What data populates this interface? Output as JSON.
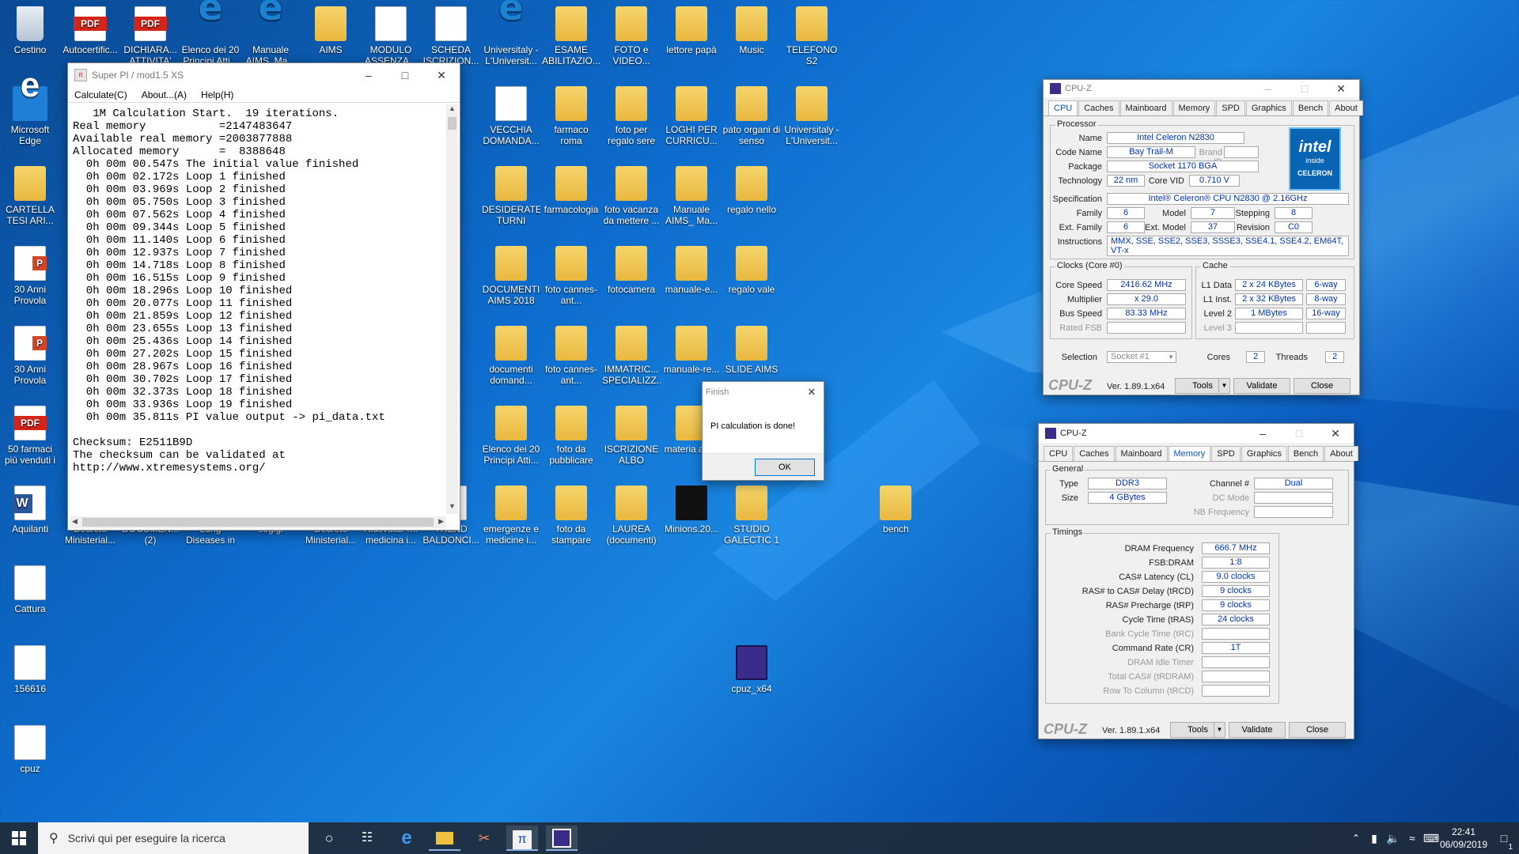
{
  "desktop_icons": [
    {
      "label": "Cestino",
      "type": "bin"
    },
    {
      "label": "Autocertific...",
      "type": "pdf"
    },
    {
      "label": "DICHIARA... ATTIVITA'",
      "type": "pdf"
    },
    {
      "label": "Elenco dei 20 Principi Atti...",
      "type": "edge"
    },
    {
      "label": "Manuale AIMS_Ma...",
      "type": "edge"
    },
    {
      "label": "AIMS",
      "type": "folder"
    },
    {
      "label": "MODULO ASSENZA...",
      "type": "doc"
    },
    {
      "label": "SCHEDA ISCRIZION...",
      "type": "doc"
    },
    {
      "label": "Universitaly - L'Universit...",
      "type": "edge"
    },
    {
      "label": "ESAME ABILITAZIO...",
      "type": "folder"
    },
    {
      "label": "FOTO e VIDEO...",
      "type": "folder"
    },
    {
      "label": "lettore papà",
      "type": "folder"
    },
    {
      "label": "Music",
      "type": "folder"
    },
    {
      "label": "TELEFONO S2",
      "type": "folder"
    },
    {
      "label": "Microsoft Edge",
      "type": "edgeblue"
    },
    {
      "label": "VECCHIA DOMANDA...",
      "type": "doc"
    },
    {
      "label": "farmaco roma",
      "type": "folder"
    },
    {
      "label": "foto per regalo sere",
      "type": "folder"
    },
    {
      "label": "LOGHI PER CURRICU...",
      "type": "folder"
    },
    {
      "label": "pato organi di senso",
      "type": "folder"
    },
    {
      "label": "Universitaly - L'Universit...",
      "type": "folder"
    },
    {
      "label": "CARTELLA TESI ARI...",
      "type": "folder"
    },
    {
      "label": "DESIDERATE TURNI INTE...",
      "type": "folder"
    },
    {
      "label": "farmacologia",
      "type": "folder"
    },
    {
      "label": "foto vacanza da mettere ...",
      "type": "folder"
    },
    {
      "label": "Manuale AIMS_ Ma...",
      "type": "folder"
    },
    {
      "label": "regalo nello",
      "type": "folder"
    },
    {
      "label": "30 Anni Provola",
      "type": "ppt"
    },
    {
      "label": "DOCUMENTI AIMS 2018",
      "type": "folder"
    },
    {
      "label": "foto cannes-ant...",
      "type": "folder"
    },
    {
      "label": "fotocamera",
      "type": "folder"
    },
    {
      "label": "manuale-e...",
      "type": "folder"
    },
    {
      "label": "regalo vale",
      "type": "folder"
    },
    {
      "label": "30 Anni Provola",
      "type": "ppt"
    },
    {
      "label": "documenti domand...",
      "type": "folder"
    },
    {
      "label": "foto cannes-ant...",
      "type": "folder"
    },
    {
      "label": "IMMATRIC... SPECIALIZZ...",
      "type": "folder"
    },
    {
      "label": "manuale-re...",
      "type": "folder"
    },
    {
      "label": "SLIDE AIMS",
      "type": "folder"
    },
    {
      "label": "50 farmaci più venduti i",
      "type": "pdf"
    },
    {
      "label": "Elenco dei 20 Principi Atti...",
      "type": "folder"
    },
    {
      "label": "foto da pubblicare",
      "type": "folder"
    },
    {
      "label": "ISCRIZIONE ALBO",
      "type": "folder"
    },
    {
      "label": "materia aims",
      "type": "folder"
    },
    {
      "label": "Aquilanti",
      "type": "word"
    },
    {
      "label": "Decreto Ministerial...",
      "type": "doc"
    },
    {
      "label": "DOCUMEN... (2)",
      "type": "doc"
    },
    {
      "label": "Lung Diseases in I...",
      "type": "doc"
    },
    {
      "label": "sogigi",
      "type": "doc"
    },
    {
      "label": "Decreto Ministerial...",
      "type": "doc"
    },
    {
      "label": "RicevutaPr... medicina i...",
      "type": "doc"
    },
    {
      "label": "TREND BALDONCI...",
      "type": "doc"
    },
    {
      "label": "emergenze e medicine i...",
      "type": "folder"
    },
    {
      "label": "foto da stampare",
      "type": "folder"
    },
    {
      "label": "LAUREA (documenti)",
      "type": "folder"
    },
    {
      "label": "Minions.20...",
      "type": "black"
    },
    {
      "label": "STUDIO GALECTIC 1",
      "type": "folder"
    },
    {
      "label": "bench",
      "type": "folder"
    },
    {
      "label": "Cattura",
      "type": "app"
    },
    {
      "label": "156616",
      "type": "app"
    },
    {
      "label": "cpuz_x64",
      "type": "cpuz"
    },
    {
      "label": "cpuz",
      "type": "doc"
    }
  ],
  "superpi": {
    "title": "Super PI / mod1.5 XS",
    "menu": [
      "Calculate(C)",
      "About...(A)",
      "Help(H)"
    ],
    "lines": [
      "   1M Calculation Start.  19 iterations.",
      "Real memory           =2147483647",
      "Available real memory =2003877888",
      "Allocated memory      =  8388648",
      "  0h 00m 00.547s The initial value finished",
      "  0h 00m 02.172s Loop 1 finished",
      "  0h 00m 03.969s Loop 2 finished",
      "  0h 00m 05.750s Loop 3 finished",
      "  0h 00m 07.562s Loop 4 finished",
      "  0h 00m 09.344s Loop 5 finished",
      "  0h 00m 11.140s Loop 6 finished",
      "  0h 00m 12.937s Loop 7 finished",
      "  0h 00m 14.718s Loop 8 finished",
      "  0h 00m 16.515s Loop 9 finished",
      "  0h 00m 18.296s Loop 10 finished",
      "  0h 00m 20.077s Loop 11 finished",
      "  0h 00m 21.859s Loop 12 finished",
      "  0h 00m 23.655s Loop 13 finished",
      "  0h 00m 25.436s Loop 14 finished",
      "  0h 00m 27.202s Loop 15 finished",
      "  0h 00m 28.967s Loop 16 finished",
      "  0h 00m 30.702s Loop 17 finished",
      "  0h 00m 32.373s Loop 18 finished",
      "  0h 00m 33.936s Loop 19 finished",
      "  0h 00m 35.811s PI value output -> pi_data.txt",
      "",
      "Checksum: E2511B9D",
      "The checksum can be validated at",
      "http://www.xtremesystems.org/"
    ]
  },
  "finish_dialog": {
    "title": "Finish",
    "message": "PI calculation is done!",
    "ok": "OK"
  },
  "cpuz_cpu": {
    "title": "CPU-Z",
    "tabs": [
      "CPU",
      "Caches",
      "Mainboard",
      "Memory",
      "SPD",
      "Graphics",
      "Bench",
      "About"
    ],
    "active_tab": "CPU",
    "group_processor": "Processor",
    "name_label": "Name",
    "name": "Intel Celeron N2830",
    "codename_label": "Code Name",
    "codename": "Bay Trail-M",
    "brandid_label": "Brand ID",
    "package_label": "Package",
    "package": "Socket 1170 BGA",
    "technology_label": "Technology",
    "technology": "22 nm",
    "corevid_label": "Core VID",
    "corevid": "0.710 V",
    "spec_label": "Specification",
    "spec": "Intel® Celeron® CPU  N2830  @ 2.16GHz",
    "family_label": "Family",
    "family": "6",
    "model_label": "Model",
    "model": "7",
    "stepping_label": "Stepping",
    "stepping": "8",
    "extfamily_label": "Ext. Family",
    "extfamily": "6",
    "extmodel_label": "Ext. Model",
    "extmodel": "37",
    "revision_label": "Revision",
    "revision": "C0",
    "instr_label": "Instructions",
    "instr": "MMX, SSE, SSE2, SSE3, SSSE3, SSE4.1, SSE4.2, EM64T, VT-x",
    "group_clocks": "Clocks (Core #0)",
    "corespeed_label": "Core Speed",
    "corespeed": "2416.62 MHz",
    "multiplier_label": "Multiplier",
    "multiplier": "x 29.0",
    "busspeed_label": "Bus Speed",
    "busspeed": "83.33 MHz",
    "ratedfsb_label": "Rated FSB",
    "group_cache": "Cache",
    "l1d_label": "L1 Data",
    "l1d": "2 x 24 KBytes",
    "l1d_way": "6-way",
    "l1i_label": "L1 Inst.",
    "l1i": "2 x 32 KBytes",
    "l1i_way": "8-way",
    "l2_label": "Level 2",
    "l2": "1 MBytes",
    "l2_way": "16-way",
    "l3_label": "Level 3",
    "selection_label": "Selection",
    "selection": "Socket #1",
    "cores_label": "Cores",
    "cores": "2",
    "threads_label": "Threads",
    "threads": "2",
    "logo": "CPU-Z",
    "version": "Ver. 1.89.1.x64",
    "tools": "Tools",
    "validate": "Validate",
    "close": "Close",
    "intel_brand": "intel",
    "intel_inside": "inside",
    "intel_line": "CELERON"
  },
  "cpuz_mem": {
    "title": "CPU-Z",
    "tabs": [
      "CPU",
      "Caches",
      "Mainboard",
      "Memory",
      "SPD",
      "Graphics",
      "Bench",
      "About"
    ],
    "active_tab": "Memory",
    "group_general": "General",
    "type_label": "Type",
    "type": "DDR3",
    "size_label": "Size",
    "size": "4 GBytes",
    "channel_label": "Channel #",
    "channel": "Dual",
    "dcmode_label": "DC Mode",
    "nbfreq_label": "NB Frequency",
    "group_timings": "Timings",
    "timings": [
      {
        "label": "DRAM Frequency",
        "value": "666.7 MHz",
        "dim": false
      },
      {
        "label": "FSB:DRAM",
        "value": "1:8",
        "dim": false
      },
      {
        "label": "CAS# Latency (CL)",
        "value": "9.0 clocks",
        "dim": false
      },
      {
        "label": "RAS# to CAS# Delay (tRCD)",
        "value": "9 clocks",
        "dim": false
      },
      {
        "label": "RAS# Precharge (tRP)",
        "value": "9 clocks",
        "dim": false
      },
      {
        "label": "Cycle Time (tRAS)",
        "value": "24 clocks",
        "dim": false
      },
      {
        "label": "Bank Cycle Time (tRC)",
        "value": "",
        "dim": true
      },
      {
        "label": "Command Rate (CR)",
        "value": "1T",
        "dim": false
      },
      {
        "label": "DRAM Idle Timer",
        "value": "",
        "dim": true
      },
      {
        "label": "Total CAS# (tRDRAM)",
        "value": "",
        "dim": true
      },
      {
        "label": "Row To Column (tRCD)",
        "value": "",
        "dim": true
      }
    ],
    "logo": "CPU-Z",
    "version": "Ver. 1.89.1.x64",
    "tools": "Tools",
    "validate": "Validate",
    "close": "Close"
  },
  "taskbar": {
    "search_placeholder": "Scrivi qui per eseguire la ricerca",
    "time": "22:41",
    "date": "06/09/2019",
    "notifications": "1"
  }
}
